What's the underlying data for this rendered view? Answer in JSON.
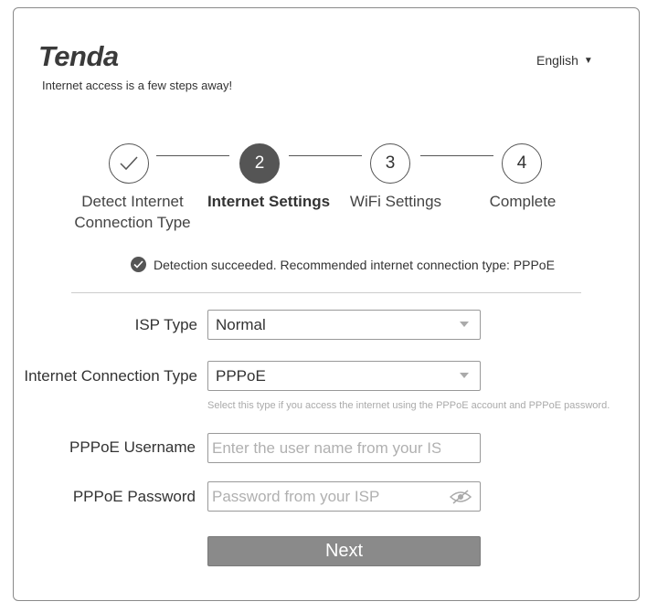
{
  "header": {
    "logo_text": "Tenda",
    "tagline": "Internet access is a few steps away!",
    "language": "English"
  },
  "steps": [
    {
      "number": "",
      "label_line1": "Detect Internet",
      "label_line2": "Connection Type",
      "state": "done"
    },
    {
      "number": "2",
      "label_line1": "Internet Settings",
      "label_line2": "",
      "state": "active"
    },
    {
      "number": "3",
      "label_line1": "WiFi Settings",
      "label_line2": "",
      "state": "pending"
    },
    {
      "number": "4",
      "label_line1": "Complete",
      "label_line2": "",
      "state": "pending"
    }
  ],
  "detection": {
    "message": "Detection succeeded. Recommended internet connection type: PPPoE"
  },
  "form": {
    "isp_type": {
      "label": "ISP Type",
      "value": "Normal"
    },
    "connection_type": {
      "label": "Internet Connection Type",
      "value": "PPPoE",
      "hint": "Select this type if you access the internet using the PPPoE account and PPPoE password."
    },
    "username": {
      "label": "PPPoE Username",
      "placeholder": "Enter the user name from your ISP",
      "value": ""
    },
    "password": {
      "label": "PPPoE Password",
      "placeholder": "Password from your ISP",
      "value": ""
    }
  },
  "actions": {
    "next_label": "Next"
  },
  "colors": {
    "accent": "#555555",
    "button": "#8a8a8a",
    "border": "#999999"
  }
}
